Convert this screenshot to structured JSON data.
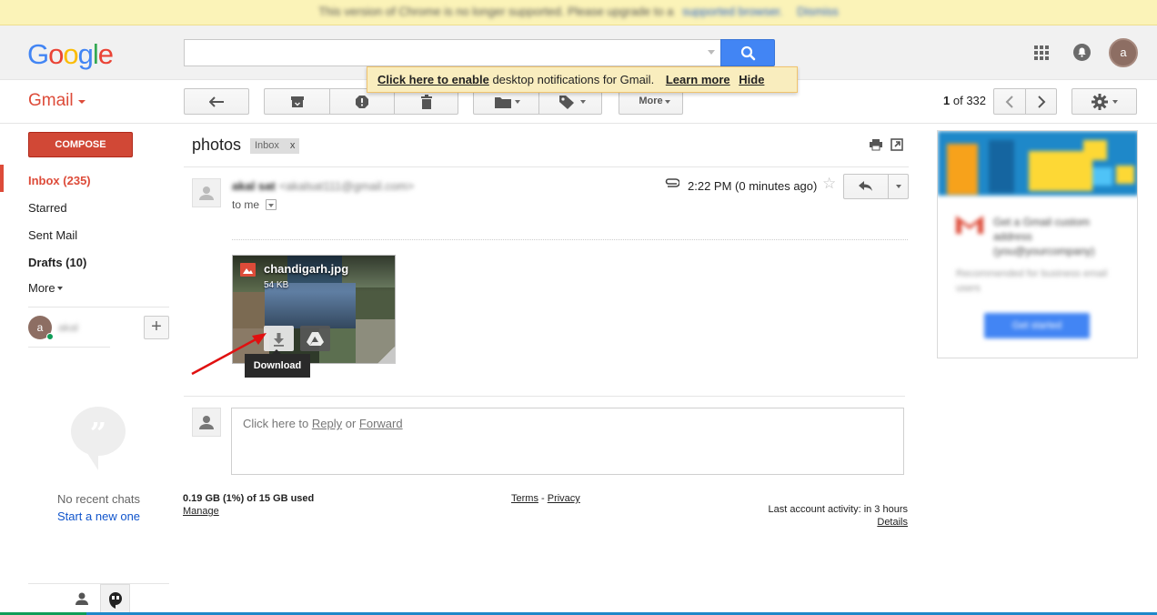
{
  "browser_banner": {
    "message": "This version of Chrome is no longer supported. Please upgrade to a",
    "link": "supported browser.",
    "dismiss": "Dismiss"
  },
  "header": {
    "logo_letters": [
      "G",
      "o",
      "o",
      "g",
      "l",
      "e"
    ],
    "logo_colors": [
      "#4285f4",
      "#ea4335",
      "#fbbc05",
      "#4285f4",
      "#34a853",
      "#ea4335"
    ],
    "search_value": "",
    "avatar_initial": "a"
  },
  "notification": {
    "enable_link": "Click here to enable",
    "text": " desktop notifications for Gmail.",
    "learn_more": "Learn more",
    "hide": "Hide"
  },
  "toolbar": {
    "app_name": "Gmail",
    "more_label": "More",
    "pager_current": "1",
    "pager_of": " of ",
    "pager_total": "332"
  },
  "sidebar": {
    "compose": "COMPOSE",
    "items": [
      {
        "label": "Inbox (235)"
      },
      {
        "label": "Starred"
      },
      {
        "label": "Sent Mail"
      },
      {
        "label": "Drafts (10)"
      },
      {
        "label": "More"
      }
    ],
    "hangout_user": "akal",
    "hangout_initial": "a",
    "no_chats": "No recent chats",
    "start_new": "Start a new one"
  },
  "message": {
    "subject": "photos",
    "label": "Inbox",
    "label_remove": "x",
    "sender_name": "akal sat",
    "sender_email": "<akalsat111@gmail.com>",
    "to": "to me",
    "time": "2:22 PM (0 minutes ago)",
    "attachment_name": "chandigarh.jpg",
    "attachment_size": "54 KB",
    "tooltip": "Download",
    "reply_prefix": "Click here to ",
    "reply_link": "Reply",
    "reply_or": " or ",
    "forward_link": "Forward"
  },
  "footer": {
    "storage": "0.19 GB (1%) of 15 GB used",
    "manage": "Manage",
    "terms": "Terms",
    "dash": " - ",
    "privacy": "Privacy",
    "last_activity": "Last account activity: in 3 hours",
    "details": "Details"
  },
  "ad": {
    "title": "Get a Gmail custom address (you@yourcompany)",
    "subtitle": "Recommended for business email users",
    "button": "Get started"
  },
  "colors": {
    "gmail_red": "#dd4b39",
    "compose_red": "#d14836",
    "search_blue": "#4285f4",
    "link_blue": "#1155cc"
  }
}
